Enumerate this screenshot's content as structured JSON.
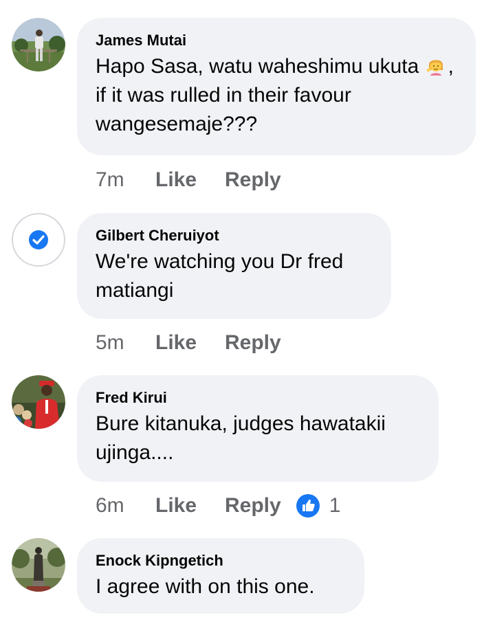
{
  "comments": [
    {
      "author": "James Mutai",
      "text_before_emoji": "Hapo Sasa, watu waheshimu ukuta ",
      "emoji": "person-tipping-hand-icon",
      "text_after_emoji": ", if it was rulled in their favour wangesemaje???",
      "time": "7m",
      "like_label": "Like",
      "reply_label": "Reply"
    },
    {
      "author": "Gilbert Cheruiyot",
      "text": "We're watching you Dr fred matiangi",
      "time": "5m",
      "like_label": "Like",
      "reply_label": "Reply",
      "avatar_badge": "check-circle-icon"
    },
    {
      "author": "Fred Kirui",
      "text": "Bure kitanuka, judges hawatakii ujinga....",
      "time": "6m",
      "like_label": "Like",
      "reply_label": "Reply",
      "reaction_icon": "like-reaction-icon",
      "reaction_count": "1"
    },
    {
      "author": "Enock Kipngetich",
      "text": "I agree with on this one."
    }
  ],
  "colors": {
    "bubble": "#f0f2f5",
    "meta_text": "#65676b",
    "accent": "#1877f2"
  }
}
